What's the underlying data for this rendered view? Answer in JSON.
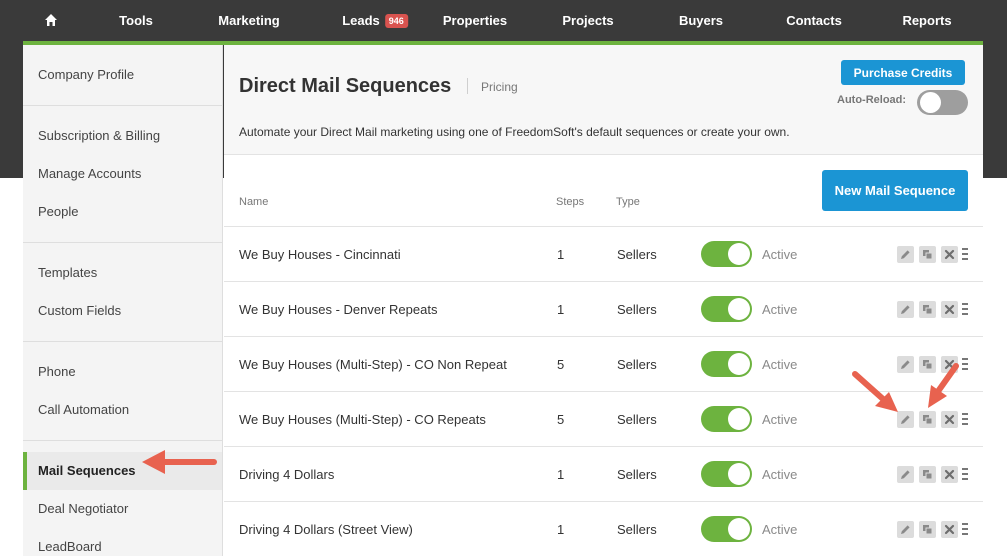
{
  "nav": {
    "items": [
      {
        "name": "nav-tools",
        "label": "Tools"
      },
      {
        "name": "nav-marketing",
        "label": "Marketing"
      },
      {
        "name": "nav-leads",
        "label": "Leads"
      },
      {
        "name": "nav-properties",
        "label": "Properties"
      },
      {
        "name": "nav-projects",
        "label": "Projects"
      },
      {
        "name": "nav-buyers",
        "label": "Buyers"
      },
      {
        "name": "nav-contacts",
        "label": "Contacts"
      },
      {
        "name": "nav-reports",
        "label": "Reports"
      }
    ],
    "leads_badge": "946"
  },
  "sidebar": {
    "groups": [
      [
        "Company Profile"
      ],
      [
        "Subscription & Billing",
        "Manage Accounts",
        "People"
      ],
      [
        "Templates",
        "Custom Fields"
      ],
      [
        "Phone",
        "Call Automation"
      ],
      [
        "Mail Sequences",
        "Deal Negotiator",
        "LeadBoard"
      ]
    ],
    "active": "Mail Sequences"
  },
  "header": {
    "title": "Direct Mail Sequences",
    "pricing_label": "Pricing",
    "purchase_label": "Purchase Credits",
    "auto_reload_label": "Auto-Reload:",
    "description": "Automate your Direct Mail marketing using one of FreedomSoft's default sequences or create your own."
  },
  "table": {
    "columns": {
      "name": "Name",
      "steps": "Steps",
      "type": "Type"
    },
    "new_button_label": "New Mail Sequence",
    "rows": [
      {
        "name": "We Buy Houses - Cincinnati",
        "steps": "1",
        "type": "Sellers",
        "status": "Active"
      },
      {
        "name": "We Buy Houses - Denver Repeats",
        "steps": "1",
        "type": "Sellers",
        "status": "Active"
      },
      {
        "name": "We Buy Houses (Multi-Step) - CO Non Repeat",
        "steps": "5",
        "type": "Sellers",
        "status": "Active"
      },
      {
        "name": "We Buy Houses (Multi-Step) - CO Repeats",
        "steps": "5",
        "type": "Sellers",
        "status": "Active"
      },
      {
        "name": "Driving 4 Dollars",
        "steps": "1",
        "type": "Sellers",
        "status": "Active"
      },
      {
        "name": "Driving 4 Dollars (Street View)",
        "steps": "1",
        "type": "Sellers",
        "status": "Active"
      }
    ]
  },
  "colors": {
    "accent_green": "#6db33f",
    "primary_blue": "#1b95d4",
    "nav_dark": "#3a3a3a",
    "annotation_red": "#e8624f",
    "badge_red": "#d9534f"
  },
  "icons": {
    "home": "home-icon",
    "edit": "pencil-icon",
    "copy": "copy-icon",
    "delete": "close-icon",
    "drag": "drag-handle-icon"
  }
}
